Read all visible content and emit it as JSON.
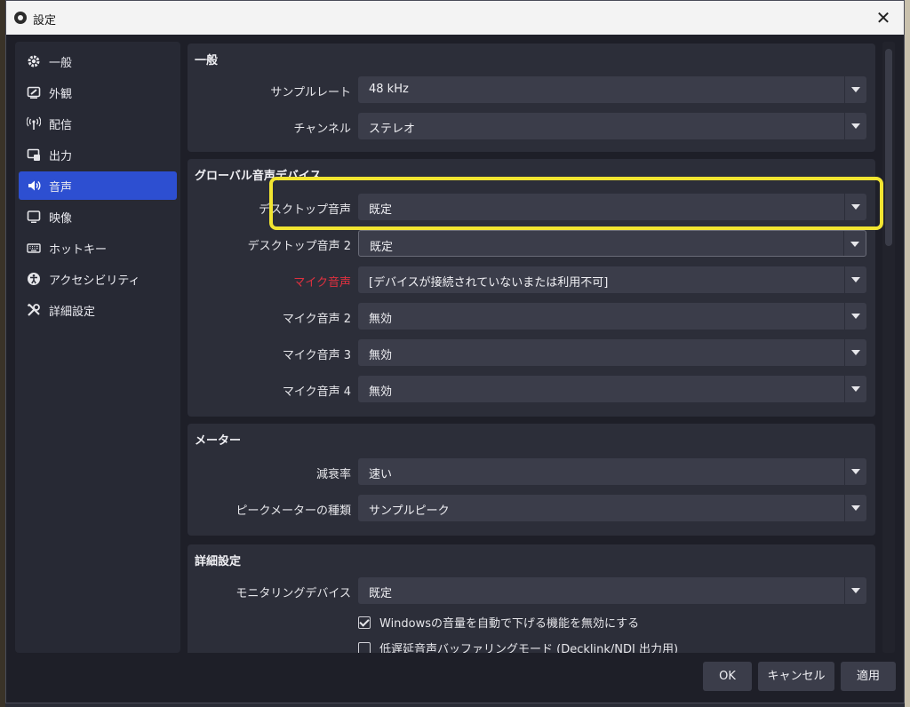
{
  "window": {
    "title": "設定"
  },
  "sidebar": {
    "items": [
      {
        "label": "一般",
        "icon": "gear-icon"
      },
      {
        "label": "外観",
        "icon": "appearance-icon"
      },
      {
        "label": "配信",
        "icon": "broadcast-icon"
      },
      {
        "label": "出力",
        "icon": "output-icon"
      },
      {
        "label": "音声",
        "icon": "speaker-icon",
        "active": true
      },
      {
        "label": "映像",
        "icon": "monitor-icon"
      },
      {
        "label": "ホットキー",
        "icon": "keyboard-icon"
      },
      {
        "label": "アクセシビリティ",
        "icon": "accessibility-icon"
      },
      {
        "label": "詳細設定",
        "icon": "tools-icon"
      }
    ]
  },
  "general": {
    "title": "一般",
    "sample_rate": {
      "label": "サンプルレート",
      "value": "48 kHz"
    },
    "channel": {
      "label": "チャンネル",
      "value": "ステレオ"
    }
  },
  "devices": {
    "title": "グローバル音声デバイス",
    "desktop1": {
      "label": "デスクトップ音声",
      "value": "既定"
    },
    "desktop2": {
      "label": "デスクトップ音声 2",
      "value": "既定"
    },
    "mic1": {
      "label": "マイク音声",
      "value": "[デバイスが接続されていないまたは利用不可]"
    },
    "mic2": {
      "label": "マイク音声 2",
      "value": "無効"
    },
    "mic3": {
      "label": "マイク音声 3",
      "value": "無効"
    },
    "mic4": {
      "label": "マイク音声 4",
      "value": "無効"
    }
  },
  "meters": {
    "title": "メーター",
    "decay": {
      "label": "減衰率",
      "value": "速い"
    },
    "peak_type": {
      "label": "ピークメーターの種類",
      "value": "サンプルピーク"
    }
  },
  "advanced": {
    "title": "詳細設定",
    "monitoring": {
      "label": "モニタリングデバイス",
      "value": "既定"
    },
    "ducking": {
      "label": "Windowsの音量を自動で下げる機能を無効にする",
      "checked": true
    },
    "low_latency": {
      "label": "低遅延音声バッファリングモード (Decklink/NDI 出力用)",
      "checked": false
    }
  },
  "footer": {
    "ok": "OK",
    "cancel": "キャンセル",
    "apply": "適用"
  },
  "colors": {
    "accent": "#2d4fd1",
    "highlight": "#f2e531",
    "warning_label": "#e0313f"
  }
}
